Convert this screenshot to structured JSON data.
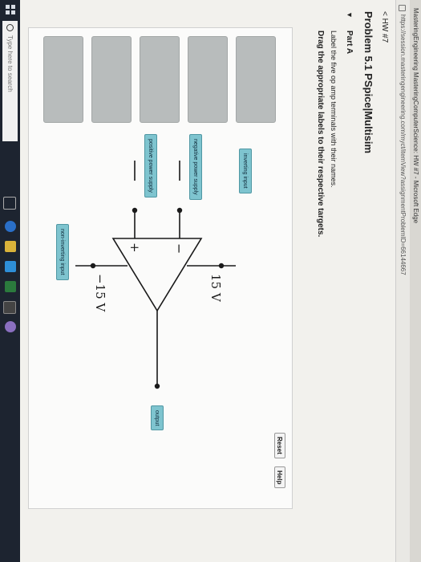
{
  "window": {
    "title": "MasteringEngineering MasteringComputerScience: HW #7 - Microsoft Edge",
    "url": "https://session.masteringengineering.com/myct/itemView?assignmentProblemID=66144667"
  },
  "nav": {
    "back_link": "< HW #7"
  },
  "problem": {
    "title": "Problem 5.1 PSpice|Multisim",
    "part_toggle": "▼",
    "part": "Part A",
    "instruction": "Label the five op amp terminals with their names.",
    "instruction_bold": "Drag the appropriate labels to their respective targets."
  },
  "toolbar": {
    "reset_label": "Reset",
    "help_label": "Help"
  },
  "labels": [
    "inverting input",
    "negative power supply",
    "positive power supply",
    "output",
    "non-inverting input"
  ],
  "circuit": {
    "top_voltage": "15 V",
    "bottom_voltage": "−15 V",
    "minus_sign": "−",
    "plus_sign": "+"
  },
  "taskbar": {
    "search_placeholder": "Type here to search"
  },
  "colors": {
    "chip": "#7ec4cf",
    "slot": "#b8bcbc",
    "taskbar": "#1d2430"
  }
}
